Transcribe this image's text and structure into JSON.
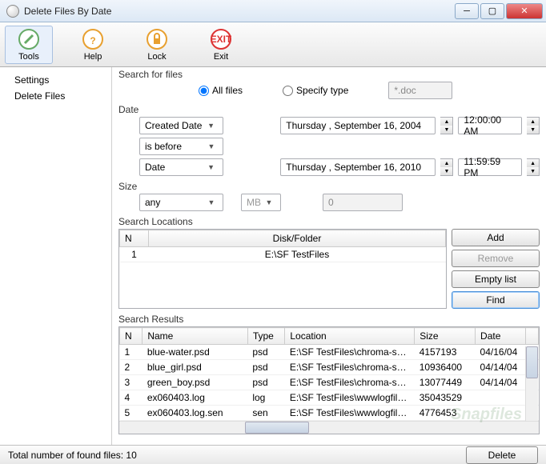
{
  "window": {
    "title": "Delete Files By Date"
  },
  "toolbar": {
    "tools_label": "Tools",
    "help_label": "Help",
    "lock_label": "Lock",
    "exit_label": "Exit"
  },
  "sidebar": {
    "items": [
      {
        "label": "Settings"
      },
      {
        "label": "Delete Files"
      }
    ]
  },
  "search_files": {
    "group_label": "Search for files",
    "all_files_label": "All files",
    "specify_type_label": "Specify type",
    "type_pattern": "*.doc"
  },
  "date": {
    "group_label": "Date",
    "field_combo": "Created Date",
    "op_combo": "is before",
    "against_combo": "Date",
    "date1": "Thursday , September 16, 2004",
    "time1": "12:00:00 AM",
    "date2": "Thursday , September 16, 2010",
    "time2": "11:59:59 PM"
  },
  "size": {
    "group_label": "Size",
    "mode": "any",
    "unit": "MB",
    "value": "0"
  },
  "locations": {
    "group_label": "Search Locations",
    "col_n": "N",
    "col_path": "Disk/Folder",
    "add_label": "Add",
    "remove_label": "Remove",
    "empty_label": "Empty list",
    "find_label": "Find",
    "rows": [
      {
        "n": "1",
        "path": "E:\\SF TestFiles"
      }
    ]
  },
  "results": {
    "group_label": "Search Results",
    "col_n": "N",
    "col_name": "Name",
    "col_type": "Type",
    "col_location": "Location",
    "col_size": "Size",
    "col_date": "Date",
    "rows": [
      {
        "n": "1",
        "name": "blue-water.psd",
        "type": "psd",
        "location": "E:\\SF TestFiles\\chroma-sa...",
        "size": "4157193",
        "date": "04/16/04"
      },
      {
        "n": "2",
        "name": "blue_girl.psd",
        "type": "psd",
        "location": "E:\\SF TestFiles\\chroma-sa...",
        "size": "10936400",
        "date": "04/14/04"
      },
      {
        "n": "3",
        "name": "green_boy.psd",
        "type": "psd",
        "location": "E:\\SF TestFiles\\chroma-sa...",
        "size": "13077449",
        "date": "04/14/04"
      },
      {
        "n": "4",
        "name": "ex060403.log",
        "type": "log",
        "location": "E:\\SF TestFiles\\wwwlogfiles\\",
        "size": "35043529",
        "date": ""
      },
      {
        "n": "5",
        "name": "ex060403.log.sen",
        "type": "sen",
        "location": "E:\\SF TestFiles\\wwwlogfiles\\",
        "size": "4776453",
        "date": ""
      }
    ]
  },
  "footer": {
    "total_text": "Total number of found files: 10",
    "delete_label": "Delete"
  },
  "watermark": "Snapfiles"
}
